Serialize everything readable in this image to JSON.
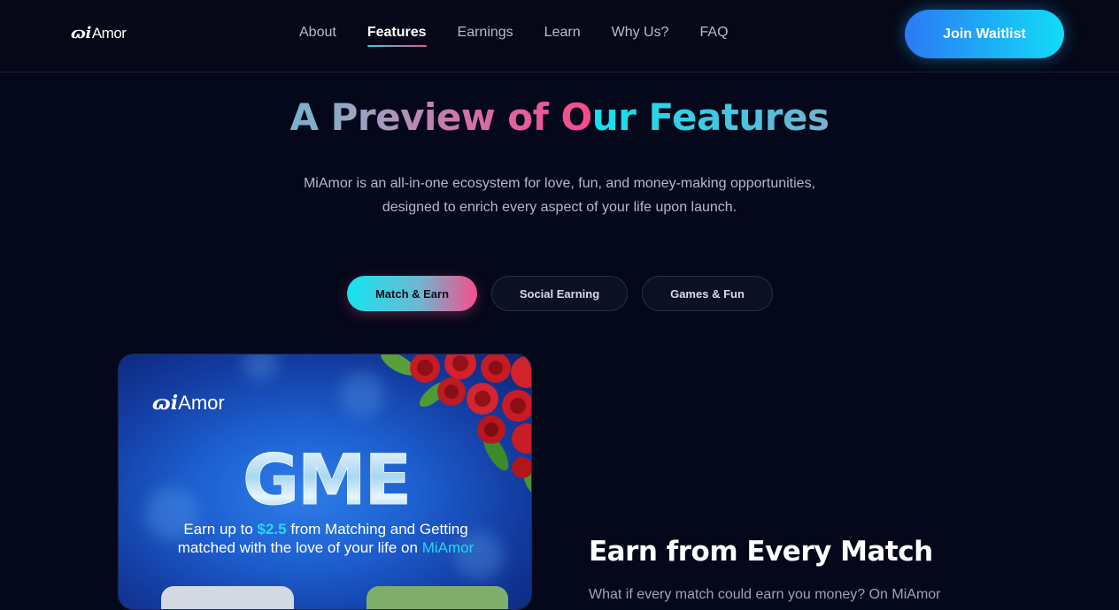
{
  "nav": {
    "logo_mark": "ɷi",
    "logo_text": "Amor",
    "items": [
      {
        "label": "About",
        "active": false
      },
      {
        "label": "Features",
        "active": true
      },
      {
        "label": "Earnings",
        "active": false
      },
      {
        "label": "Learn",
        "active": false
      },
      {
        "label": "Why Us?",
        "active": false
      },
      {
        "label": "FAQ",
        "active": false
      }
    ],
    "cta_label": "Join Waitlist"
  },
  "hero": {
    "title": "A Preview of Our Features",
    "subtitle_line1": "MiAmor is an all-in-one ecosystem for love, fun, and money-making opportunities,",
    "subtitle_line2": "designed to enrich every aspect of your life upon launch."
  },
  "tabs": [
    {
      "label": "Match & Earn",
      "active": true
    },
    {
      "label": "Social Earning",
      "active": false
    },
    {
      "label": "Games & Fun",
      "active": false
    }
  ],
  "card": {
    "logo_mark": "ɷi",
    "logo_text": "Amor",
    "big_text": "GME",
    "line1_pre": "Earn up to ",
    "line1_amount": "$2.5",
    "line1_post": " from Matching and Getting",
    "line2_pre": "matched with the love of your life on ",
    "line2_brand": "MiAmor"
  },
  "feature": {
    "title": "Earn from Every Match",
    "description": "What if every match could earn you money? On MiAmor"
  },
  "colors": {
    "background": "#05081a",
    "accent_cyan": "#14e0ee",
    "accent_pink": "#f64a8a",
    "cta_blue": "#2a79f5"
  }
}
